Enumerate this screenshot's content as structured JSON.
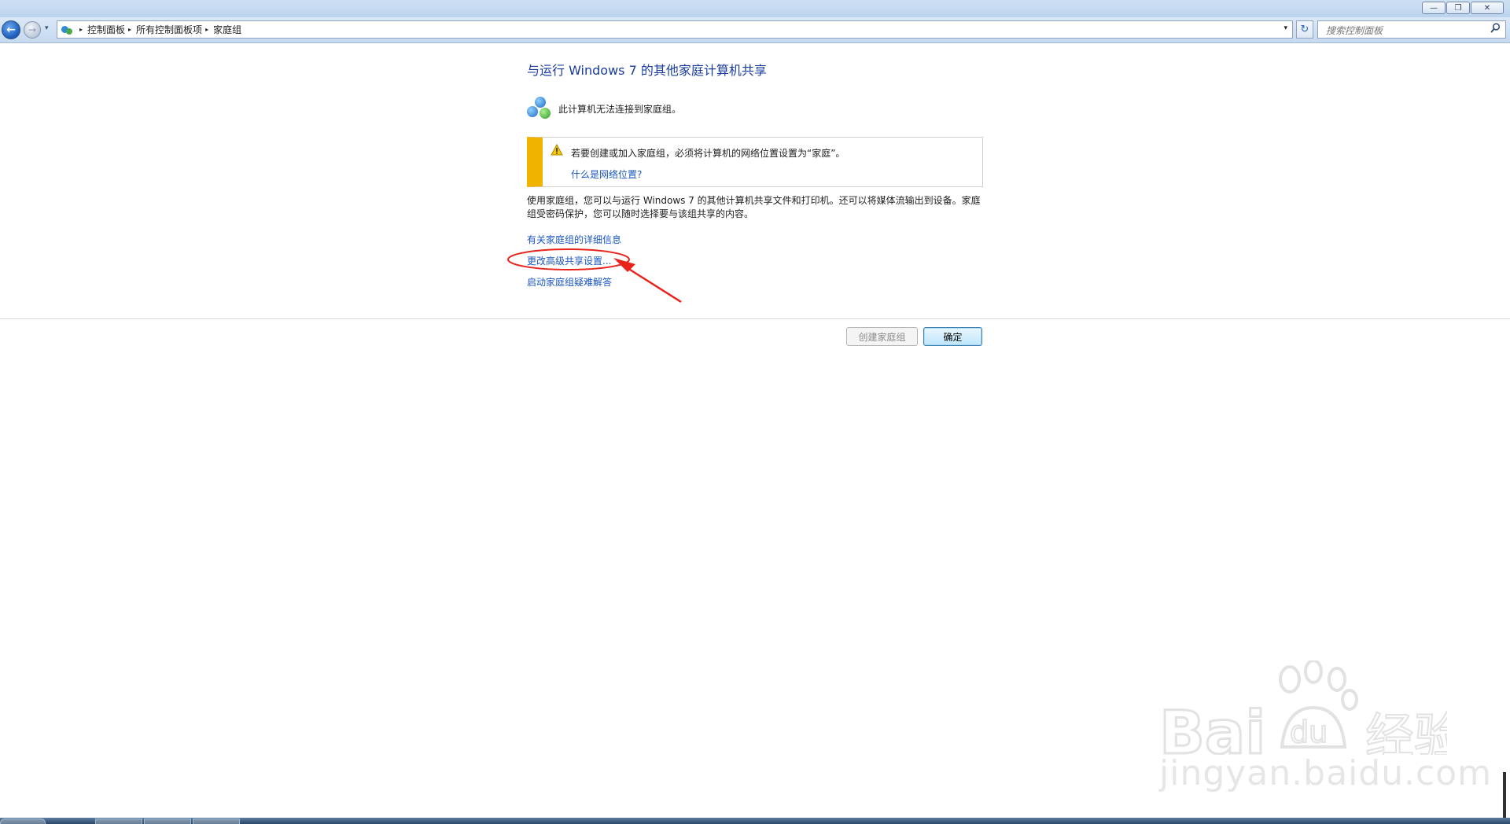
{
  "window": {
    "minimize_glyph": "—",
    "maximize_glyph": "❐",
    "close_glyph": "✕"
  },
  "nav": {
    "back_glyph": "←",
    "forward_glyph": "→",
    "recent_glyph": "▾",
    "breadcrumbs": [
      "控制面板",
      "所有控制面板项",
      "家庭组"
    ],
    "separator_glyph": "▸",
    "dropdown_glyph": "▾",
    "refresh_glyph": "↻",
    "search_placeholder": "搜索控制面板",
    "search_icon": "search-icon"
  },
  "content": {
    "title": "与运行 Windows 7 的其他家庭计算机共享",
    "status": "此计算机无法连接到家庭组。",
    "warning": {
      "text": "若要创建或加入家庭组，必须将计算机的网络位置设置为“家庭”。",
      "link": "什么是网络位置?",
      "icon": "warning-icon"
    },
    "description": "使用家庭组，您可以与运行 Windows 7 的其他计算机共享文件和打印机。还可以将媒体流输出到设备。家庭组受密码保护，您可以随时选择要与该组共享的内容。",
    "links": [
      "有关家庭组的详细信息",
      "更改高级共享设置...",
      "启动家庭组疑难解答"
    ]
  },
  "buttons": {
    "create_homegroup": "创建家庭组",
    "ok": "确定"
  },
  "watermark": {
    "brand": "Baidu经验",
    "site": "jingyan.baidu.com"
  },
  "colors": {
    "link": "#1a56c2",
    "title": "#1a3d9b",
    "warning_bar": "#f2b200",
    "annotation": "#e8231c"
  }
}
